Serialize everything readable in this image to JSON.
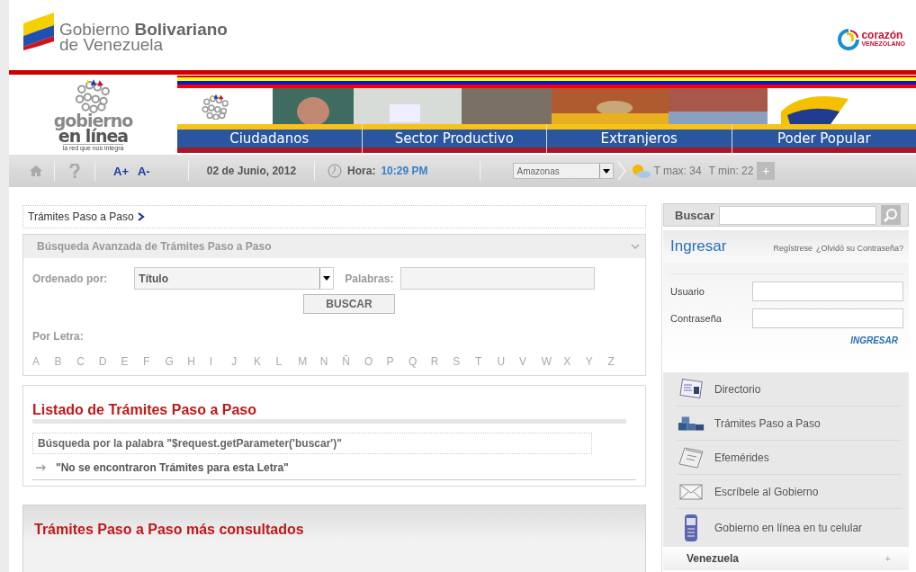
{
  "header": {
    "brand_light": "Gobierno",
    "brand_bold": "Bolivariano",
    "brand_line2": "de Venezuela",
    "partner_name": "corazón",
    "partner_sub": "VENEZOLANO"
  },
  "portal_logo": {
    "line1": "gobierno",
    "line2": "en línea",
    "tagline": "la red que nos integra"
  },
  "nav_tabs": [
    {
      "label": "Ciudadanos"
    },
    {
      "label": "Sector Productivo"
    },
    {
      "label": "Extranjeros"
    },
    {
      "label": "Poder Popular"
    }
  ],
  "toolbar": {
    "font_up": "A+",
    "font_down": "A-",
    "date": "02 de Junio, 2012",
    "time_label": "Hora:",
    "time": "10:29 PM",
    "state_select": "Amazonas",
    "t_max": "T max: 34",
    "t_min": "T min: 22",
    "more": "+"
  },
  "breadcrumb": "Trámites Paso a Paso",
  "search_panel": {
    "title": "Búsqueda Avanzada de Trámites Paso a Paso",
    "order_label": "Ordenado por:",
    "order_value": "Título",
    "words_label": "Palabras:",
    "button": "BUSCAR",
    "letters_label": "Por Letra:",
    "letters": [
      "A",
      "B",
      "C",
      "D",
      "E",
      "F",
      "G",
      "H",
      "I",
      "J",
      "K",
      "L",
      "M",
      "N",
      "Ñ",
      "O",
      "P",
      "Q",
      "R",
      "S",
      "T",
      "U",
      "V",
      "W",
      "X",
      "Y",
      "Z"
    ]
  },
  "listing": {
    "title": "Listado de Trámites Paso a Paso",
    "query": "Búsqueda por la palabra \"$request.getParameter('buscar')\"",
    "result": "\"No se encontraron Trámites para esta Letra\""
  },
  "most_consulted": {
    "title": "Trámites Paso a Paso más consultados"
  },
  "sidebar": {
    "search_label": "Buscar",
    "login_title": "Ingresar",
    "register_link": "Regístrese",
    "forgot_link": "¿Olvidó su Contraseña?",
    "user_label": "Usuario",
    "password_label": "Contraseña",
    "login_button": "INGRESAR",
    "menu": [
      {
        "kind": "directory",
        "label": "Directorio"
      },
      {
        "kind": "procedures",
        "label": "Trámites Paso a Paso"
      },
      {
        "kind": "calendar",
        "label": "Efemérides"
      },
      {
        "kind": "mail",
        "label": "Escríbele al Gobierno"
      },
      {
        "kind": "phone",
        "label": "Gobierno en línea en tu celular"
      }
    ],
    "section": {
      "label": "Venezuela",
      "toggle": "+"
    }
  }
}
